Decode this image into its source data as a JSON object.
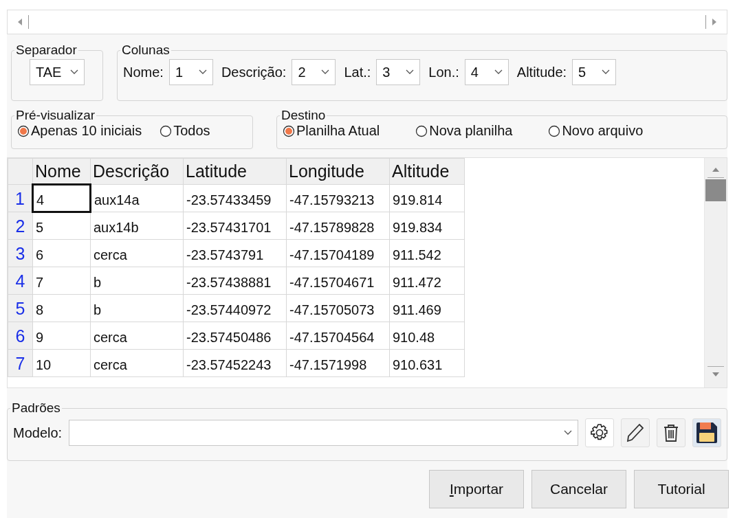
{
  "separator": {
    "legend": "Separador",
    "value": "TAE"
  },
  "columns": {
    "legend": "Colunas",
    "fields": [
      {
        "label": "Nome:",
        "value": "1"
      },
      {
        "label": "Descrição:",
        "value": "2"
      },
      {
        "label": "Lat.:",
        "value": "3"
      },
      {
        "label": "Lon.:",
        "value": "4"
      },
      {
        "label": "Altitude:",
        "value": "5"
      }
    ]
  },
  "preview": {
    "legend": "Pré-visualizar",
    "options": [
      {
        "label": "Apenas 10 iniciais",
        "selected": true
      },
      {
        "label": "Todos",
        "selected": false
      }
    ]
  },
  "destination": {
    "legend": "Destino",
    "options": [
      {
        "label": "Planilha Atual",
        "selected": true
      },
      {
        "label": "Nova planilha",
        "selected": false
      },
      {
        "label": "Novo arquivo",
        "selected": false
      }
    ]
  },
  "table": {
    "columns": [
      "Nome",
      "Descrição",
      "Latitude",
      "Longitude",
      "Altitude"
    ],
    "rows": [
      {
        "number": "1",
        "selected": true,
        "cells": [
          "4",
          "aux14a",
          "-23.57433459",
          "-47.15793213",
          "919.814"
        ]
      },
      {
        "number": "2",
        "selected": false,
        "cells": [
          "5",
          "aux14b",
          "-23.57431701",
          "-47.15789828",
          "919.834"
        ]
      },
      {
        "number": "3",
        "selected": false,
        "cells": [
          "6",
          "cerca",
          "-23.5743791",
          "-47.15704189",
          "911.542"
        ]
      },
      {
        "number": "4",
        "selected": false,
        "cells": [
          "7",
          "b",
          "-23.57438881",
          "-47.15704671",
          "911.472"
        ]
      },
      {
        "number": "5",
        "selected": false,
        "cells": [
          "8",
          "b",
          "-23.57440972",
          "-47.15705073",
          "911.469"
        ]
      },
      {
        "number": "6",
        "selected": false,
        "cells": [
          "9",
          "cerca",
          "-23.57450486",
          "-47.15704564",
          "910.48"
        ]
      },
      {
        "number": "7",
        "selected": false,
        "cells": [
          "10",
          "cerca",
          "-23.57452243",
          "-47.1571998",
          "910.631"
        ]
      }
    ]
  },
  "presets": {
    "legend": "Padrões",
    "label": "Modelo:"
  },
  "buttons": [
    {
      "label": "Importar",
      "mnemonic": true
    },
    {
      "label": "Cancelar",
      "mnemonic": false
    },
    {
      "label": "Tutorial",
      "mnemonic": false
    }
  ]
}
